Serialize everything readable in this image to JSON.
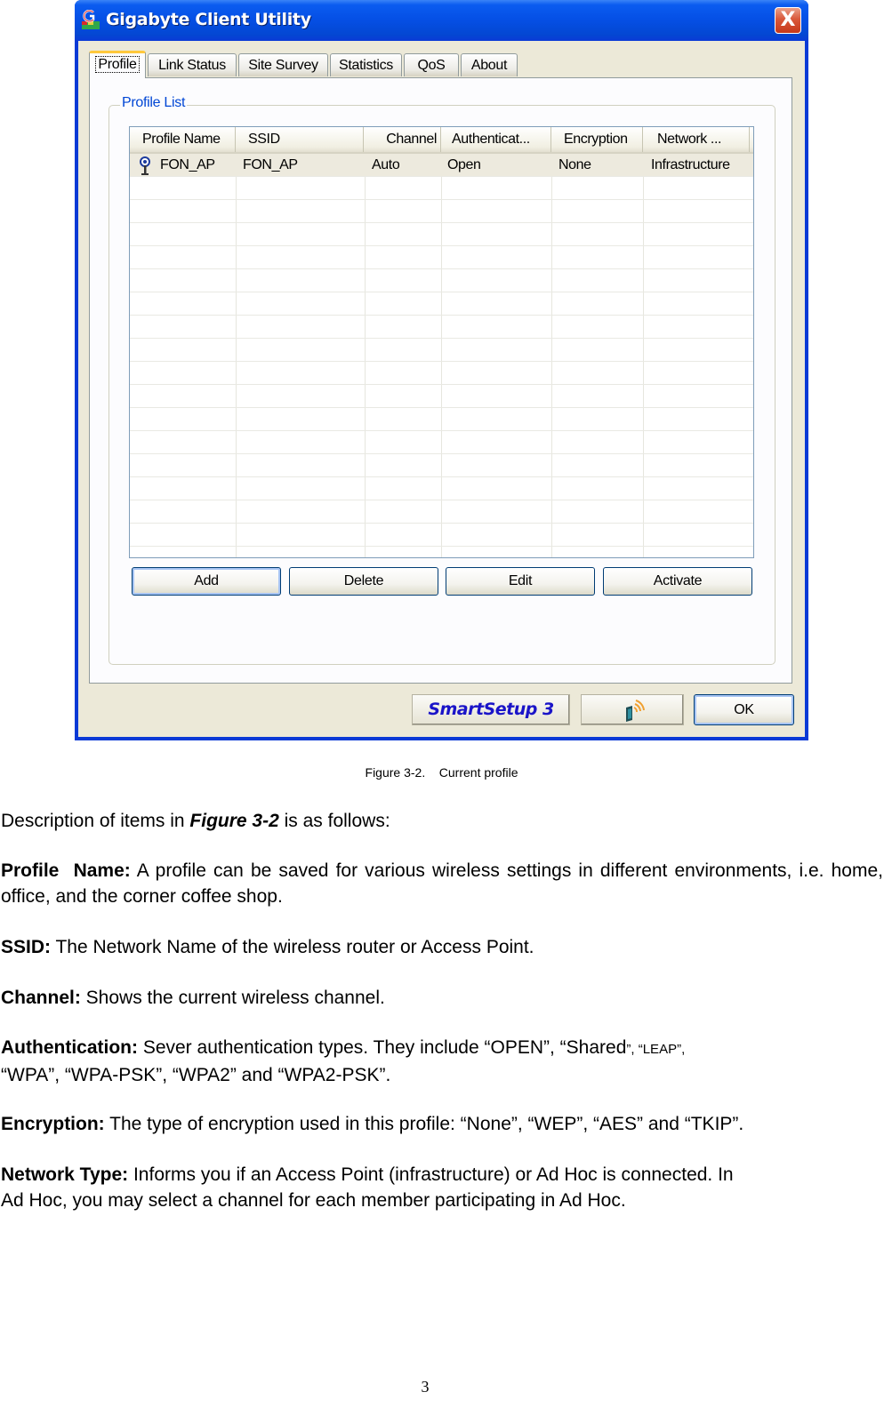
{
  "window": {
    "title": "Gigabyte Client Utility",
    "close_label": "X",
    "tabs": [
      {
        "label": "Profile",
        "active": true
      },
      {
        "label": "Link Status",
        "active": false
      },
      {
        "label": "Site Survey",
        "active": false
      },
      {
        "label": "Statistics",
        "active": false
      },
      {
        "label": "QoS",
        "active": false
      },
      {
        "label": "About",
        "active": false
      }
    ],
    "profile_list": {
      "group_label": "Profile List",
      "columns": [
        "Profile Name",
        "SSID",
        "Channel",
        "Authenticat...",
        "Encryption",
        "Network ..."
      ],
      "rows": [
        {
          "icon": "access-point-icon",
          "profile_name": "FON_AP",
          "ssid": "FON_AP",
          "channel": "Auto",
          "authentication": "Open",
          "encryption": "None",
          "network": "Infrastructure"
        }
      ]
    },
    "buttons": {
      "add": "Add",
      "delete": "Delete",
      "edit": "Edit",
      "activate": "Activate",
      "smartsetup": "SmartSetup 3",
      "wps_icon": "wireless-card-icon",
      "ok": "OK"
    }
  },
  "document": {
    "caption": "Figure 3-2.    Current profile",
    "intro": {
      "pre": "Description of items in ",
      "emph": "Figure 3-2",
      "post": " is as follows:"
    },
    "items": [
      {
        "term": "Profile  Name:",
        "text": " A profile can be saved for various wireless settings in different environments, i.e. home, office, and the corner coffee shop."
      },
      {
        "term": "SSID:",
        "text": " The Network Name of the wireless router or Access Point."
      },
      {
        "term": "Channel:",
        "text": " Shows the current wireless channel."
      },
      {
        "term": "Authentication:",
        "text": " Sever authentication types. They include “OPEN”, “Shared",
        "small": "”, “LEAP”,",
        "text2": "“WPA”, “WPA-PSK”, “WPA2” and “WPA2-PSK”."
      },
      {
        "term": "Encryption:",
        "text": " The type of encryption used in this profile: “None”, “WEP”, “AES” and “TKIP”."
      },
      {
        "term": "Network Type:",
        "text": " Informs you if an Access Point (infrastructure) or Ad Hoc is connected. In",
        "text2": "Ad Hoc, you may select a channel for each member participating in Ad Hoc."
      }
    ],
    "page_number": "3"
  }
}
